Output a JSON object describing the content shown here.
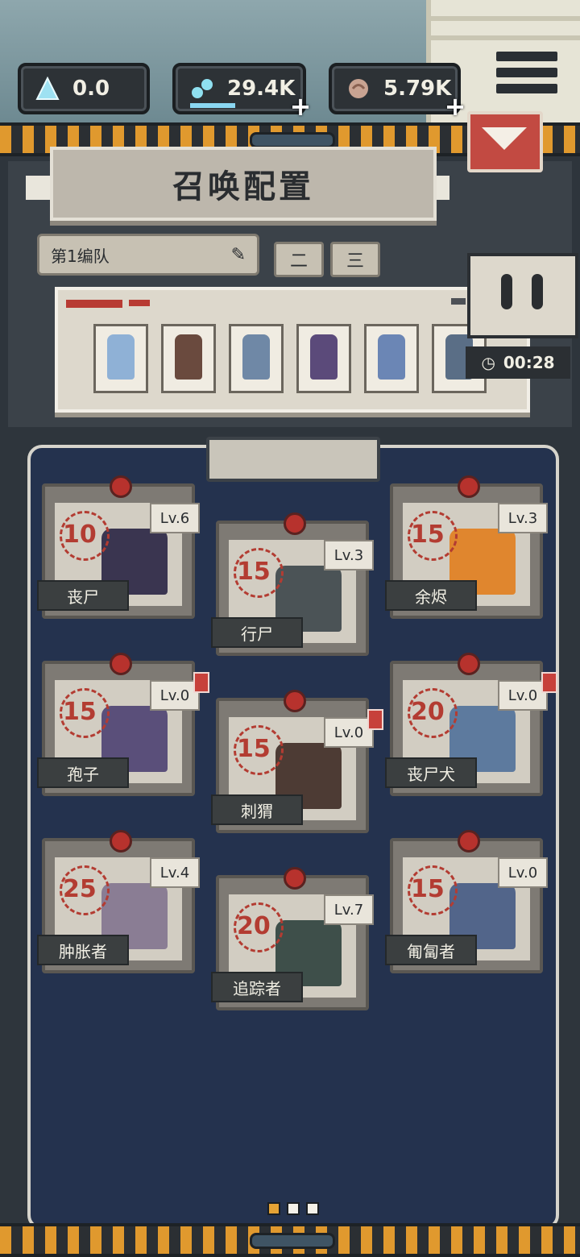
{
  "header": {
    "currencies": [
      {
        "icon": "crystal-icon",
        "value": "0.0"
      },
      {
        "icon": "dna-icon",
        "value": "29.4K"
      },
      {
        "icon": "brain-icon",
        "value": "5.79K"
      }
    ]
  },
  "panel": {
    "title": "召唤配置",
    "team_select": "第1编队",
    "team_tabs": [
      "二",
      "三"
    ],
    "timer": "00:28"
  },
  "cards": [
    {
      "name": "丧尸",
      "cost": "10",
      "level": "Lv.6",
      "new": false,
      "color": "#3a3550"
    },
    {
      "name": "行尸",
      "cost": "15",
      "level": "Lv.3",
      "new": false,
      "color": "#4b5356"
    },
    {
      "name": "余烬",
      "cost": "15",
      "level": "Lv.3",
      "new": false,
      "color": "#e0862e"
    },
    {
      "name": "孢子",
      "cost": "15",
      "level": "Lv.0",
      "new": true,
      "color": "#5a4f7a"
    },
    {
      "name": "刺猬",
      "cost": "15",
      "level": "Lv.0",
      "new": true,
      "color": "#4d3b34"
    },
    {
      "name": "丧尸犬",
      "cost": "20",
      "level": "Lv.0",
      "new": true,
      "color": "#5d7a9e"
    },
    {
      "name": "肿胀者",
      "cost": "25",
      "level": "Lv.4",
      "new": false,
      "color": "#8a7d94"
    },
    {
      "name": "追踪者",
      "cost": "20",
      "level": "Lv.7",
      "new": false,
      "color": "#3e4f4a"
    },
    {
      "name": "匍匐者",
      "cost": "15",
      "level": "Lv.0",
      "new": false,
      "color": "#52658a"
    }
  ],
  "roster_colors": [
    "#8fb1d6",
    "#6a4a3e",
    "#6f88a6",
    "#5b4a7a",
    "#6b86b5",
    "#5a6e86"
  ]
}
